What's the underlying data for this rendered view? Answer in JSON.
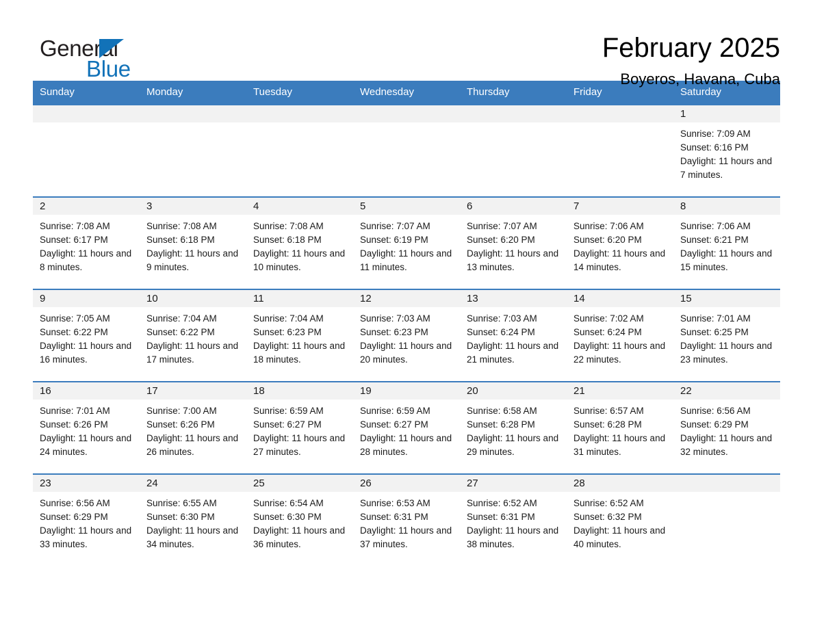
{
  "brand": {
    "name_part1": "General",
    "name_part2": "Blue",
    "accent_color": "#1272b8",
    "triangle_icon": "triangle-icon"
  },
  "header": {
    "month_title": "February 2025",
    "location": "Boyeros, Havana, Cuba"
  },
  "calendar": {
    "header_bg": "#3b7cbd",
    "daynum_bg": "#f2f2f2",
    "weekday_headers": [
      "Sunday",
      "Monday",
      "Tuesday",
      "Wednesday",
      "Thursday",
      "Friday",
      "Saturday"
    ],
    "weeks": [
      [
        {
          "day": "",
          "empty": true
        },
        {
          "day": "",
          "empty": true
        },
        {
          "day": "",
          "empty": true
        },
        {
          "day": "",
          "empty": true
        },
        {
          "day": "",
          "empty": true
        },
        {
          "day": "",
          "empty": true
        },
        {
          "day": "1",
          "sunrise": "Sunrise: 7:09 AM",
          "sunset": "Sunset: 6:16 PM",
          "daylight": "Daylight: 11 hours and 7 minutes."
        }
      ],
      [
        {
          "day": "2",
          "sunrise": "Sunrise: 7:08 AM",
          "sunset": "Sunset: 6:17 PM",
          "daylight": "Daylight: 11 hours and 8 minutes."
        },
        {
          "day": "3",
          "sunrise": "Sunrise: 7:08 AM",
          "sunset": "Sunset: 6:18 PM",
          "daylight": "Daylight: 11 hours and 9 minutes."
        },
        {
          "day": "4",
          "sunrise": "Sunrise: 7:08 AM",
          "sunset": "Sunset: 6:18 PM",
          "daylight": "Daylight: 11 hours and 10 minutes."
        },
        {
          "day": "5",
          "sunrise": "Sunrise: 7:07 AM",
          "sunset": "Sunset: 6:19 PM",
          "daylight": "Daylight: 11 hours and 11 minutes."
        },
        {
          "day": "6",
          "sunrise": "Sunrise: 7:07 AM",
          "sunset": "Sunset: 6:20 PM",
          "daylight": "Daylight: 11 hours and 13 minutes."
        },
        {
          "day": "7",
          "sunrise": "Sunrise: 7:06 AM",
          "sunset": "Sunset: 6:20 PM",
          "daylight": "Daylight: 11 hours and 14 minutes."
        },
        {
          "day": "8",
          "sunrise": "Sunrise: 7:06 AM",
          "sunset": "Sunset: 6:21 PM",
          "daylight": "Daylight: 11 hours and 15 minutes."
        }
      ],
      [
        {
          "day": "9",
          "sunrise": "Sunrise: 7:05 AM",
          "sunset": "Sunset: 6:22 PM",
          "daylight": "Daylight: 11 hours and 16 minutes."
        },
        {
          "day": "10",
          "sunrise": "Sunrise: 7:04 AM",
          "sunset": "Sunset: 6:22 PM",
          "daylight": "Daylight: 11 hours and 17 minutes."
        },
        {
          "day": "11",
          "sunrise": "Sunrise: 7:04 AM",
          "sunset": "Sunset: 6:23 PM",
          "daylight": "Daylight: 11 hours and 18 minutes."
        },
        {
          "day": "12",
          "sunrise": "Sunrise: 7:03 AM",
          "sunset": "Sunset: 6:23 PM",
          "daylight": "Daylight: 11 hours and 20 minutes."
        },
        {
          "day": "13",
          "sunrise": "Sunrise: 7:03 AM",
          "sunset": "Sunset: 6:24 PM",
          "daylight": "Daylight: 11 hours and 21 minutes."
        },
        {
          "day": "14",
          "sunrise": "Sunrise: 7:02 AM",
          "sunset": "Sunset: 6:24 PM",
          "daylight": "Daylight: 11 hours and 22 minutes."
        },
        {
          "day": "15",
          "sunrise": "Sunrise: 7:01 AM",
          "sunset": "Sunset: 6:25 PM",
          "daylight": "Daylight: 11 hours and 23 minutes."
        }
      ],
      [
        {
          "day": "16",
          "sunrise": "Sunrise: 7:01 AM",
          "sunset": "Sunset: 6:26 PM",
          "daylight": "Daylight: 11 hours and 24 minutes."
        },
        {
          "day": "17",
          "sunrise": "Sunrise: 7:00 AM",
          "sunset": "Sunset: 6:26 PM",
          "daylight": "Daylight: 11 hours and 26 minutes."
        },
        {
          "day": "18",
          "sunrise": "Sunrise: 6:59 AM",
          "sunset": "Sunset: 6:27 PM",
          "daylight": "Daylight: 11 hours and 27 minutes."
        },
        {
          "day": "19",
          "sunrise": "Sunrise: 6:59 AM",
          "sunset": "Sunset: 6:27 PM",
          "daylight": "Daylight: 11 hours and 28 minutes."
        },
        {
          "day": "20",
          "sunrise": "Sunrise: 6:58 AM",
          "sunset": "Sunset: 6:28 PM",
          "daylight": "Daylight: 11 hours and 29 minutes."
        },
        {
          "day": "21",
          "sunrise": "Sunrise: 6:57 AM",
          "sunset": "Sunset: 6:28 PM",
          "daylight": "Daylight: 11 hours and 31 minutes."
        },
        {
          "day": "22",
          "sunrise": "Sunrise: 6:56 AM",
          "sunset": "Sunset: 6:29 PM",
          "daylight": "Daylight: 11 hours and 32 minutes."
        }
      ],
      [
        {
          "day": "23",
          "sunrise": "Sunrise: 6:56 AM",
          "sunset": "Sunset: 6:29 PM",
          "daylight": "Daylight: 11 hours and 33 minutes."
        },
        {
          "day": "24",
          "sunrise": "Sunrise: 6:55 AM",
          "sunset": "Sunset: 6:30 PM",
          "daylight": "Daylight: 11 hours and 34 minutes."
        },
        {
          "day": "25",
          "sunrise": "Sunrise: 6:54 AM",
          "sunset": "Sunset: 6:30 PM",
          "daylight": "Daylight: 11 hours and 36 minutes."
        },
        {
          "day": "26",
          "sunrise": "Sunrise: 6:53 AM",
          "sunset": "Sunset: 6:31 PM",
          "daylight": "Daylight: 11 hours and 37 minutes."
        },
        {
          "day": "27",
          "sunrise": "Sunrise: 6:52 AM",
          "sunset": "Sunset: 6:31 PM",
          "daylight": "Daylight: 11 hours and 38 minutes."
        },
        {
          "day": "28",
          "sunrise": "Sunrise: 6:52 AM",
          "sunset": "Sunset: 6:32 PM",
          "daylight": "Daylight: 11 hours and 40 minutes."
        },
        {
          "day": "",
          "empty": true
        }
      ]
    ]
  }
}
